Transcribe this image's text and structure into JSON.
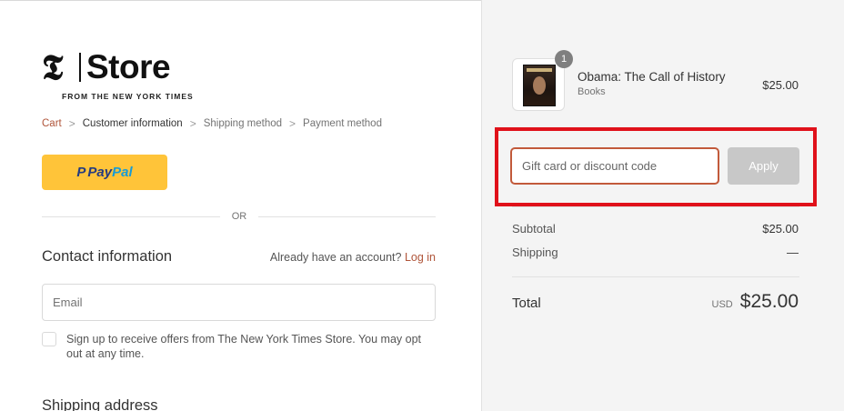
{
  "logo": {
    "mark": "𝕿",
    "wordmark": "Store",
    "subtitle": "FROM THE NEW YORK TIMES"
  },
  "breadcrumb": {
    "items": [
      {
        "label": "Cart"
      },
      {
        "label": "Customer information"
      },
      {
        "label": "Shipping method"
      },
      {
        "label": "Payment method"
      }
    ],
    "separator": ">"
  },
  "express": {
    "paypal_icon": "P",
    "paypal_pay": "Pay",
    "paypal_pal": "Pal",
    "or_label": "OR"
  },
  "contact": {
    "title": "Contact information",
    "account_prompt": "Already have an account?",
    "login_label": "Log in",
    "email_placeholder": "Email",
    "email_value": "",
    "offers_label": "Sign up to receive offers from The New York Times Store. You may opt out at any time."
  },
  "shipping": {
    "title": "Shipping address"
  },
  "order": {
    "product": {
      "name": "Obama: The Call of History",
      "category": "Books",
      "price": "$25.00",
      "quantity": "1",
      "thumb_icon": "book-cover-icon"
    },
    "discount": {
      "placeholder": "Gift card or discount code",
      "value": "",
      "apply_label": "Apply"
    },
    "subtotal_label": "Subtotal",
    "subtotal_value": "$25.00",
    "shipping_label": "Shipping",
    "shipping_value": "—",
    "total_label": "Total",
    "currency": "USD",
    "total_value": "$25.00"
  },
  "colors": {
    "link": "#b0553a",
    "paypal_yellow": "#ffc439",
    "paypal_navy": "#253b80",
    "paypal_blue": "#179bd7",
    "highlight_red": "#e0111a",
    "sidebar_bg": "#f4f4f4",
    "apply_disabled": "#c8c8c8"
  }
}
